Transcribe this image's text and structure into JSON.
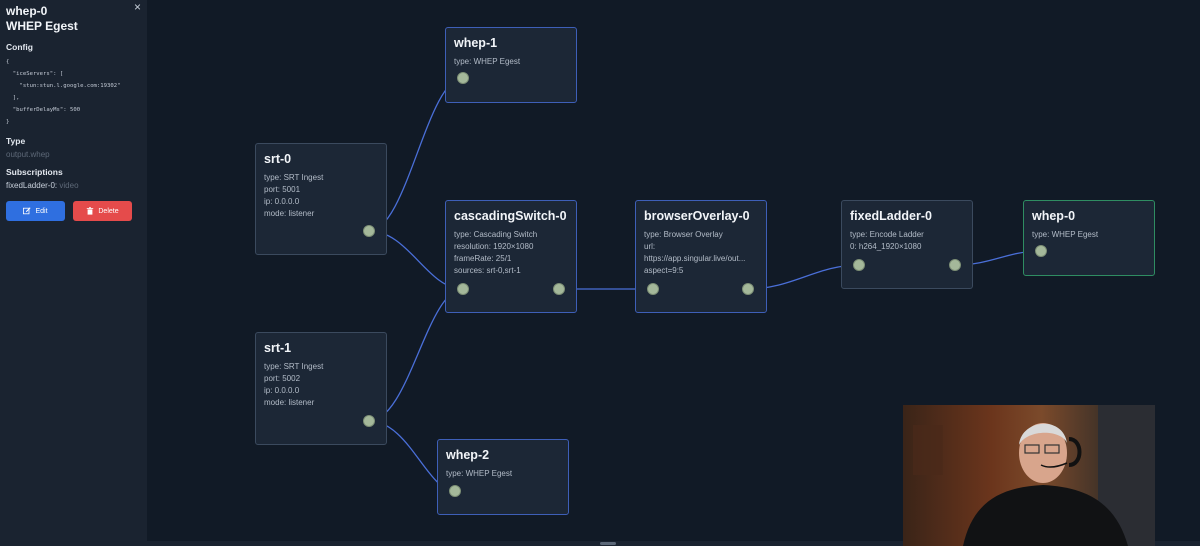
{
  "sidebar": {
    "title_line1": "whep-0",
    "title_line2": "WHEP Egest",
    "close_icon": "×",
    "config_label": "Config",
    "config_code": "{\n  \"iceServers\": [\n    \"stun:stun.l.google.com:19302\"\n  ],\n  \"bufferDelayMs\": 500\n}",
    "type_label": "Type",
    "type_value": "output.whep",
    "subscriptions_label": "Subscriptions",
    "subscription_source": "fixedLadder-0:",
    "subscription_kind": "video",
    "edit_label": "Edit",
    "delete_label": "Delete",
    "colors": {
      "edit": "#2f6fe0",
      "delete": "#e54b4b"
    }
  },
  "nodes": {
    "whep1": {
      "title": "whep-1",
      "lines": [
        "type: WHEP Egest"
      ]
    },
    "srt0": {
      "title": "srt-0",
      "lines": [
        "type: SRT Ingest",
        "port: 5001",
        "ip: 0.0.0.0",
        "mode: listener"
      ]
    },
    "srt1": {
      "title": "srt-1",
      "lines": [
        "type: SRT Ingest",
        "port: 5002",
        "ip: 0.0.0.0",
        "mode: listener"
      ]
    },
    "cascading": {
      "title": "cascadingSwitch-0",
      "lines": [
        "type: Cascading Switch",
        "resolution: 1920×1080",
        "frameRate: 25/1",
        "sources: srt-0,srt-1"
      ]
    },
    "browser": {
      "title": "browserOverlay-0",
      "lines": [
        "type: Browser Overlay",
        "url:",
        "https://app.singular.live/out...",
        "aspect=9:5"
      ]
    },
    "ladder": {
      "title": "fixedLadder-0",
      "lines": [
        "type: Encode Ladder",
        "0: h264_1920×1080"
      ]
    },
    "whep0": {
      "title": "whep-0",
      "lines": [
        "type: WHEP Egest"
      ]
    },
    "whep2": {
      "title": "whep-2",
      "lines": [
        "type: WHEP Egest"
      ]
    }
  },
  "colors": {
    "edge": "#4a6fd8",
    "port": "#a4b89a",
    "selected_border": "#2f8d62"
  }
}
